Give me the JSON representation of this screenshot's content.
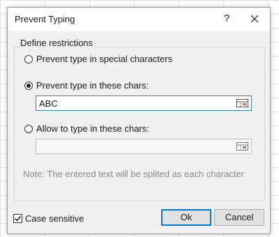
{
  "dialog": {
    "title": "Prevent Typing",
    "help_label": "?"
  },
  "restrictions": {
    "legend": "Define restrictions",
    "option_special": "Prevent type in special characters",
    "option_prevent_chars": "Prevent type in these chars:",
    "prevent_chars_value": "ABC",
    "option_allow_chars": "Allow to type in these chars:",
    "allow_chars_value": "",
    "selected": "prevent_chars",
    "note": "Note: The entered text will be splited as each character"
  },
  "footer": {
    "case_sensitive_label": "Case sensitive",
    "case_sensitive_checked": true,
    "ok_label": "Ok",
    "cancel_label": "Cancel"
  },
  "colors": {
    "accent": "#0078d7",
    "note_text": "#8a8a8a"
  },
  "icons": {
    "help": "question-mark",
    "close": "x-close",
    "range_select": "range-select-icon"
  }
}
